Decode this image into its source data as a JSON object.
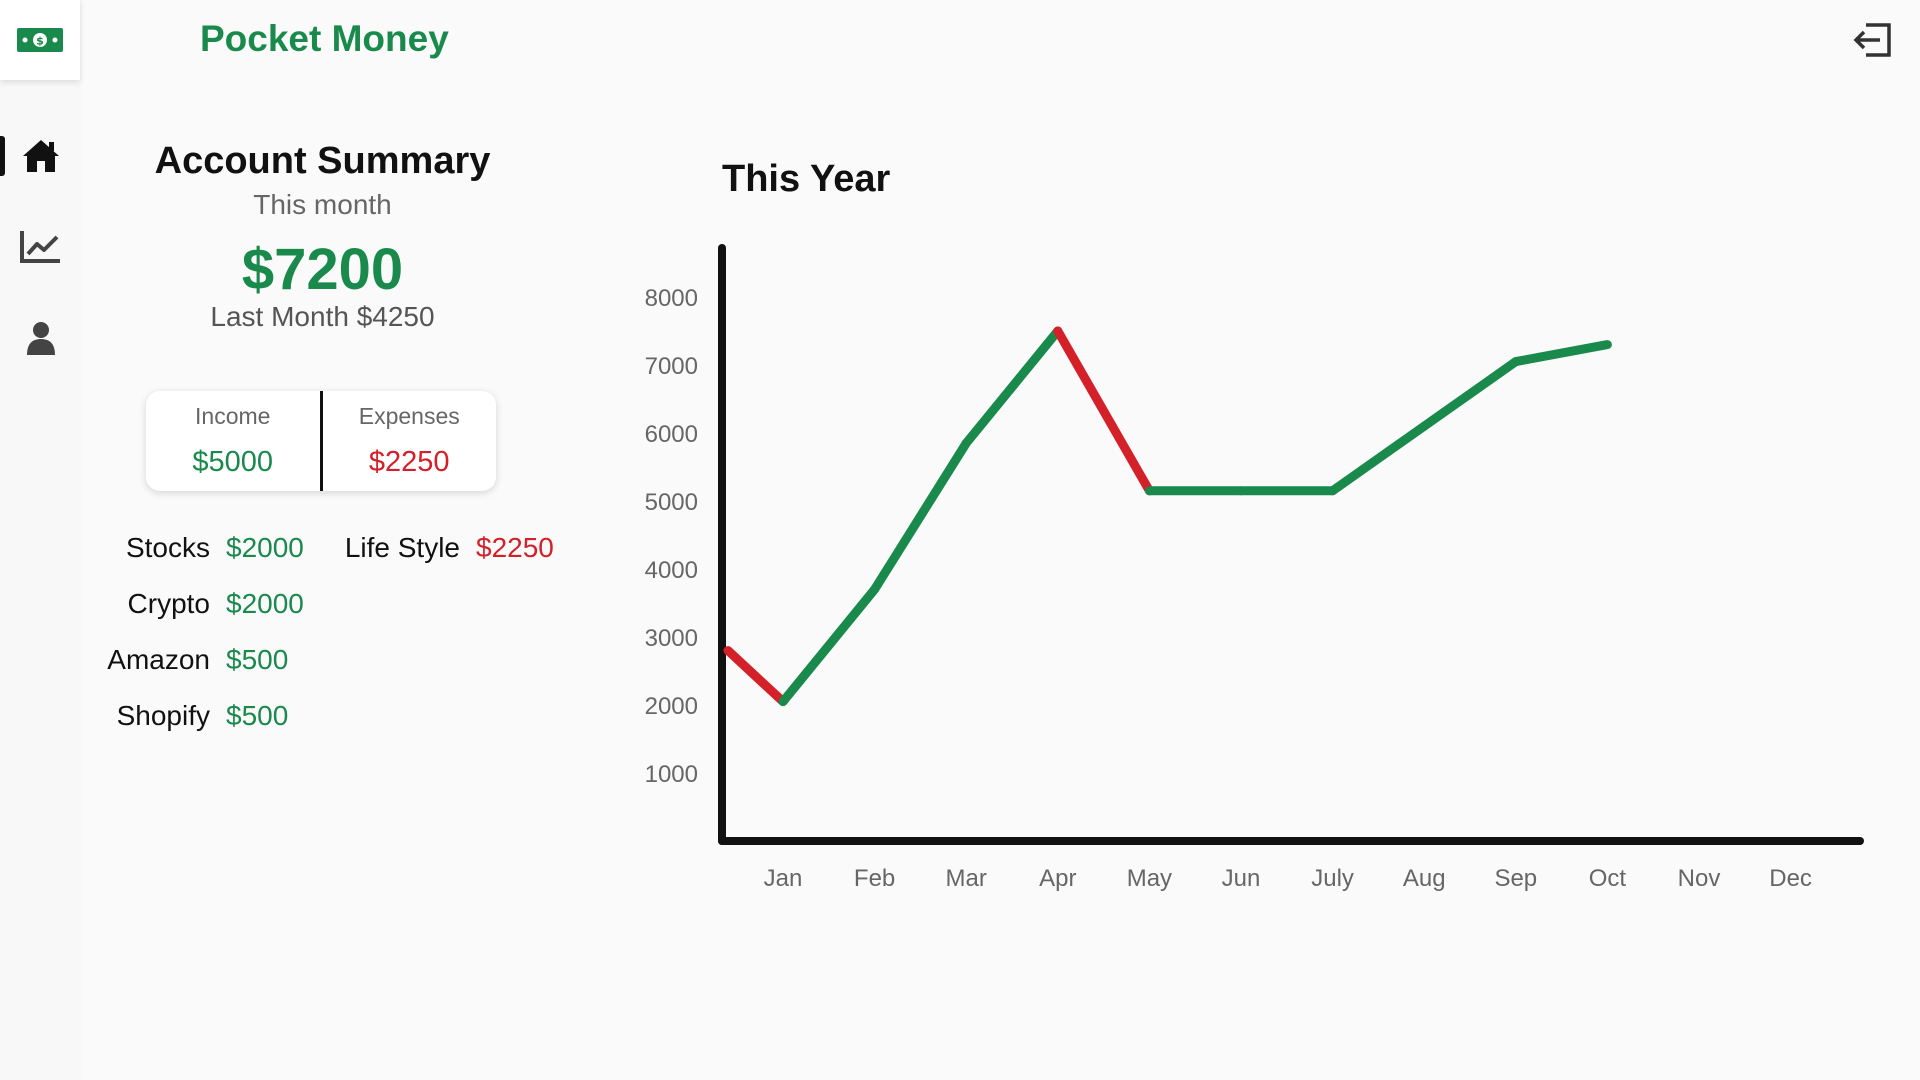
{
  "app": {
    "title": "Pocket Money"
  },
  "icons": {
    "logo": "cash-icon",
    "logout": "logout-icon",
    "nav": [
      "home-icon",
      "chart-line-icon",
      "user-icon"
    ]
  },
  "colors": {
    "accent": "#198a4c",
    "negative": "#d42028",
    "text": "#111111"
  },
  "summary": {
    "title": "Account Summary",
    "subtitle": "This month",
    "amount": "$7200",
    "last_month": "Last Month $4250"
  },
  "income_expenses": {
    "income_label": "Income",
    "income_value": "$5000",
    "expenses_label": "Expenses",
    "expenses_value": "$2250"
  },
  "breakdown": {
    "income": [
      {
        "name": "Stocks",
        "value": "$2000"
      },
      {
        "name": "Crypto",
        "value": "$2000"
      },
      {
        "name": "Amazon",
        "value": "$500"
      },
      {
        "name": "Shopify",
        "value": "$500"
      }
    ],
    "expenses": [
      {
        "name": "Life Style",
        "value": "$2250"
      }
    ]
  },
  "chart_data": {
    "type": "line",
    "title": "This Year",
    "xlabel": "",
    "ylabel": "",
    "categories": [
      "Jan",
      "Feb",
      "Mar",
      "Apr",
      "May",
      "Jun",
      "July",
      "Aug",
      "Sep",
      "Oct",
      "Nov",
      "Dec"
    ],
    "yticks": [
      1000,
      2000,
      3000,
      4000,
      5000,
      6000,
      7000,
      8000
    ],
    "ylim": [
      0,
      8800
    ],
    "start_value": 2800,
    "values": [
      2050,
      3700,
      5850,
      7500,
      5150,
      5150,
      5150,
      6100,
      7050,
      7300,
      null,
      null
    ],
    "colors": {
      "up": "#198a4c",
      "down": "#d42028"
    },
    "grid": false,
    "legend": "none"
  }
}
